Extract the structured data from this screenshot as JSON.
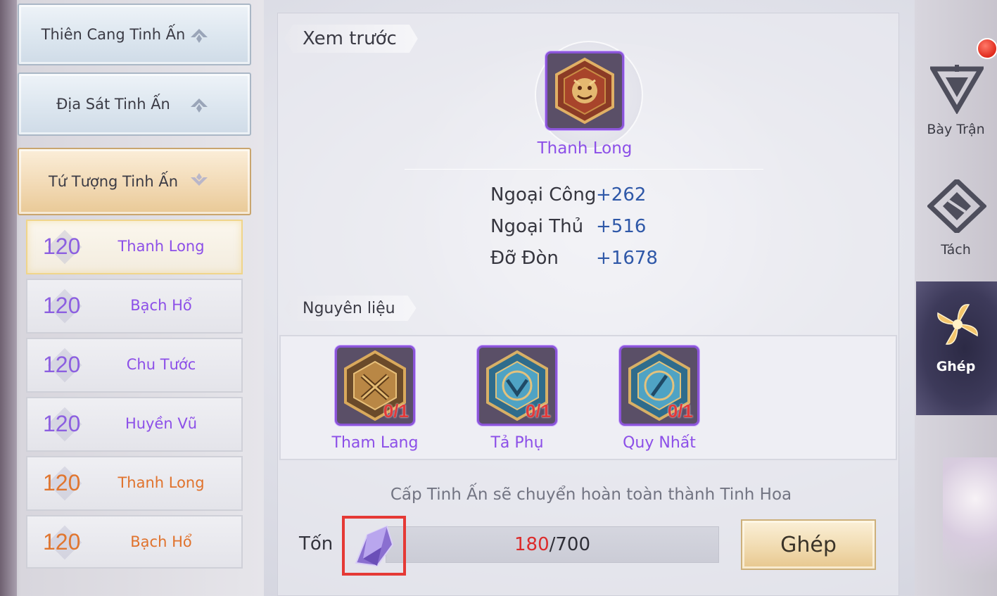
{
  "sidebar": {
    "categories": [
      {
        "label": "Thiên Cang Tinh Ấn",
        "arrow": "chevron-up-icon"
      },
      {
        "label": "Địa Sát Tinh Ấn",
        "arrow": "chevron-up-icon"
      },
      {
        "label": "Tứ Tượng Tinh Ấn",
        "arrow": "chevron-down-icon"
      }
    ],
    "items": [
      {
        "level": "120",
        "name": "Thanh Long",
        "color": "#8c4fe8"
      },
      {
        "level": "120",
        "name": "Bạch Hổ",
        "color": "#8c4fe8"
      },
      {
        "level": "120",
        "name": "Chu Tước",
        "color": "#8c4fe8"
      },
      {
        "level": "120",
        "name": "Huyền Vũ",
        "color": "#8c4fe8"
      },
      {
        "level": "120",
        "name": "Thanh Long",
        "color": "#e0722c"
      },
      {
        "level": "120",
        "name": "Bạch Hổ",
        "color": "#e0722c"
      }
    ]
  },
  "preview": {
    "title": "Xem trước",
    "item_name": "Thanh Long",
    "stats": [
      {
        "label": "Ngoại Công",
        "value": "+262"
      },
      {
        "label": "Ngoại Thủ",
        "value": "+516"
      },
      {
        "label": "Đỡ Đòn",
        "value": "+1678"
      }
    ]
  },
  "materials": {
    "title": "Nguyên liệu",
    "items": [
      {
        "name": "Tham Lang",
        "count": "0/1",
        "icon": "bronze-seal-icon"
      },
      {
        "name": "Tả Phụ",
        "count": "0/1",
        "icon": "blue-seal-icon"
      },
      {
        "name": "Quy Nhất",
        "count": "0/1",
        "icon": "blue-seal-icon"
      }
    ]
  },
  "note": "Cấp Tinh Ấn sẽ chuyển hoàn toàn thành Tinh Hoa",
  "cost": {
    "label": "Tốn",
    "have": "180",
    "need": "/700",
    "icon": "purple-crystal-icon"
  },
  "action": {
    "ghep_label": "Ghép"
  },
  "nav": [
    {
      "label": "Bày Trận",
      "icon": "formation-icon"
    },
    {
      "label": "Tách",
      "icon": "split-icon"
    },
    {
      "label": "Ghép",
      "icon": "combine-icon",
      "active": true
    }
  ],
  "colors": {
    "accent_purple": "#8c4fe8",
    "accent_orange": "#e0722c",
    "stat_blue": "#2f58a8",
    "warning_red": "#dc2b2b"
  }
}
